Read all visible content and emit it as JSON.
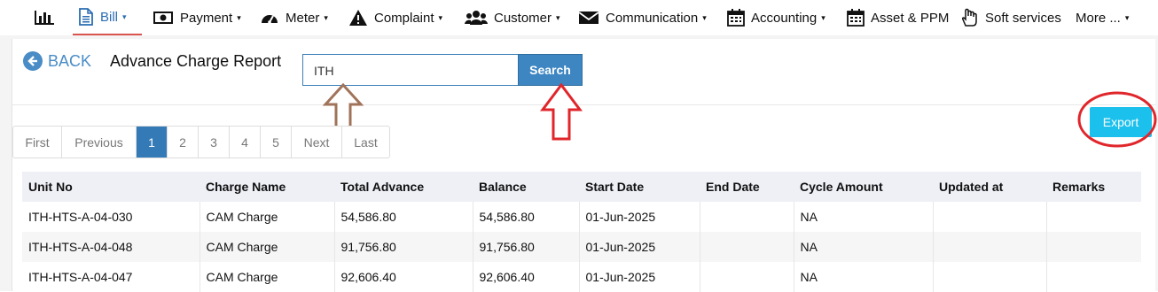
{
  "nav": {
    "items": [
      {
        "label": "",
        "icon": "bar-chart-icon"
      },
      {
        "label": "Bill",
        "icon": "document-icon",
        "caret": "▾"
      },
      {
        "label": "Payment",
        "icon": "money-icon",
        "caret": "▾"
      },
      {
        "label": "Meter",
        "icon": "dashboard-icon",
        "caret": "▾"
      },
      {
        "label": "Complaint",
        "icon": "warning-icon",
        "caret": "▾"
      },
      {
        "label": "Customer",
        "icon": "users-icon",
        "caret": "▾"
      },
      {
        "label": "Communication",
        "icon": "envelope-icon",
        "caret": "▾"
      },
      {
        "label": "Accounting",
        "icon": "calendar-icon",
        "caret": "▾"
      },
      {
        "label": "Asset & PPM",
        "icon": "calendar-icon",
        "caret": ""
      },
      {
        "label": "Soft services",
        "icon": "hand-icon",
        "caret": ""
      },
      {
        "label": "More ...",
        "icon": "",
        "caret": "▾"
      }
    ]
  },
  "header": {
    "back_label": "BACK",
    "title": "Advance Charge Report"
  },
  "search": {
    "value": "ITH",
    "button_label": "Search"
  },
  "export_label": "Export",
  "pagination": [
    "First",
    "Previous",
    "1",
    "2",
    "3",
    "4",
    "5",
    "Next",
    "Last"
  ],
  "pagination_active": "1",
  "table": {
    "columns": [
      "Unit No",
      "Charge Name",
      "Total Advance",
      "Balance",
      "Start Date",
      "End Date",
      "Cycle Amount",
      "Updated at",
      "Remarks"
    ],
    "rows": [
      [
        "ITH-HTS-A-04-030",
        "CAM Charge",
        "54,586.80",
        "54,586.80",
        "01-Jun-2025",
        "",
        "NA",
        "",
        ""
      ],
      [
        "ITH-HTS-A-04-048",
        "CAM Charge",
        "91,756.80",
        "91,756.80",
        "01-Jun-2025",
        "",
        "NA",
        "",
        ""
      ],
      [
        "ITH-HTS-A-04-047",
        "CAM Charge",
        "92,606.40",
        "92,606.40",
        "01-Jun-2025",
        "",
        "NA",
        "",
        ""
      ]
    ]
  },
  "colors": {
    "accent": "#337ab7",
    "export": "#1cc0ec",
    "annotation_red": "#e0262b",
    "annotation_brown": "#a0735a"
  }
}
